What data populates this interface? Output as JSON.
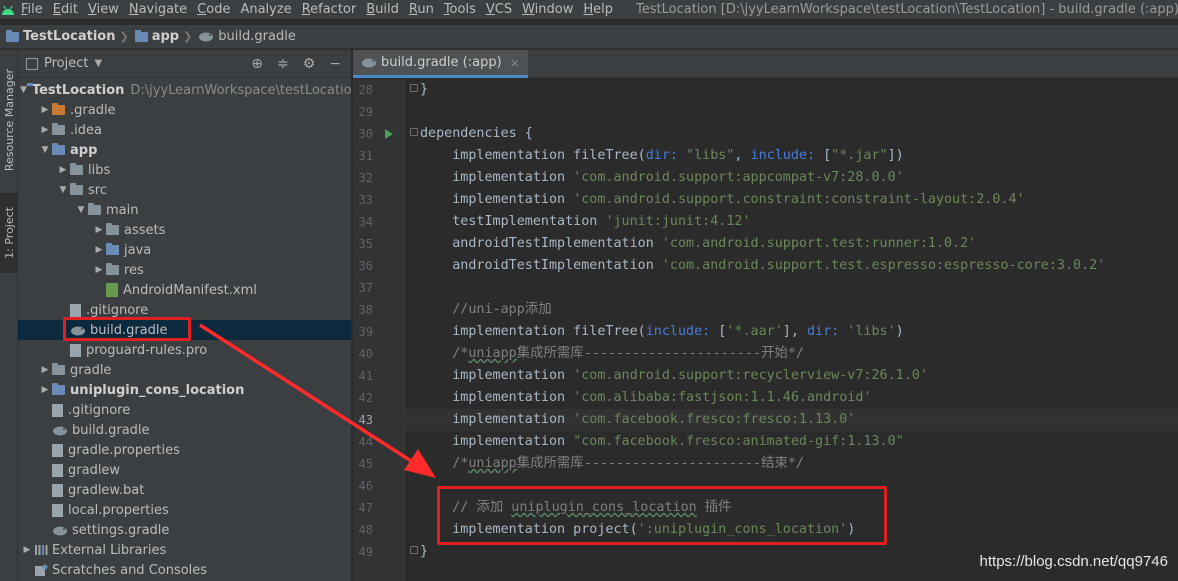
{
  "menubar": {
    "items": [
      {
        "label": "File",
        "mnemonic": "F",
        "rest": "ile"
      },
      {
        "label": "Edit",
        "mnemonic": "E",
        "rest": "dit"
      },
      {
        "label": "View",
        "mnemonic": "V",
        "rest": "iew"
      },
      {
        "label": "Navigate",
        "mnemonic": "N",
        "rest": "avigate"
      },
      {
        "label": "Code",
        "mnemonic": "C",
        "rest": "ode"
      },
      {
        "label": "Analyze",
        "mnemonic": "",
        "rest": "Analyze"
      },
      {
        "label": "Refactor",
        "mnemonic": "R",
        "rest": "efactor"
      },
      {
        "label": "Build",
        "mnemonic": "B",
        "rest": "uild"
      },
      {
        "label": "Run",
        "mnemonic": "R",
        "rest": "un"
      },
      {
        "label": "Tools",
        "mnemonic": "T",
        "rest": "ools"
      },
      {
        "label": "VCS",
        "mnemonic": "V",
        "rest": "CS"
      },
      {
        "label": "Window",
        "mnemonic": "W",
        "rest": "indow"
      },
      {
        "label": "Help",
        "mnemonic": "H",
        "rest": "elp"
      }
    ],
    "window_title": "TestLocation [D:\\jyyLearnWorkspace\\testLocation\\TestLocation] - build.gradle (:app) - Android S"
  },
  "breadcrumbs": {
    "project": "TestLocation",
    "module": "app",
    "file": "build.gradle"
  },
  "left_strip": {
    "resource_manager": "Resource Manager",
    "project_tab": "1: Project"
  },
  "project_panel": {
    "title": "Project",
    "tree": [
      {
        "label": "TestLocation",
        "path": "D:\\jyyLearnWorkspace\\testLocation\\",
        "indent": 0,
        "arrow": "open",
        "icon": "folder-blue",
        "bold": true
      },
      {
        "label": ".gradle",
        "indent": 1,
        "arrow": "closed",
        "icon": "folder-orange"
      },
      {
        "label": ".idea",
        "indent": 1,
        "arrow": "closed",
        "icon": "folder"
      },
      {
        "label": "app",
        "indent": 1,
        "arrow": "open",
        "icon": "folder-blue",
        "bold": true
      },
      {
        "label": "libs",
        "indent": 2,
        "arrow": "closed",
        "icon": "folder"
      },
      {
        "label": "src",
        "indent": 2,
        "arrow": "open",
        "icon": "folder"
      },
      {
        "label": "main",
        "indent": 3,
        "arrow": "open",
        "icon": "folder"
      },
      {
        "label": "assets",
        "indent": 4,
        "arrow": "closed",
        "icon": "folder"
      },
      {
        "label": "java",
        "indent": 4,
        "arrow": "closed",
        "icon": "folder-blue"
      },
      {
        "label": "res",
        "indent": 4,
        "arrow": "closed",
        "icon": "folder"
      },
      {
        "label": "AndroidManifest.xml",
        "indent": 4,
        "arrow": "none",
        "icon": "manifest"
      },
      {
        "label": ".gitignore",
        "indent": 2,
        "arrow": "none",
        "icon": "file"
      },
      {
        "label": "build.gradle",
        "indent": 2,
        "arrow": "none",
        "icon": "gradle",
        "selected": true
      },
      {
        "label": "proguard-rules.pro",
        "indent": 2,
        "arrow": "none",
        "icon": "file"
      },
      {
        "label": "gradle",
        "indent": 1,
        "arrow": "closed",
        "icon": "folder"
      },
      {
        "label": "uniplugin_cons_location",
        "indent": 1,
        "arrow": "closed",
        "icon": "folder-blue",
        "bold": true
      },
      {
        "label": ".gitignore",
        "indent": 1,
        "arrow": "none",
        "icon": "file"
      },
      {
        "label": "build.gradle",
        "indent": 1,
        "arrow": "none",
        "icon": "gradle"
      },
      {
        "label": "gradle.properties",
        "indent": 1,
        "arrow": "none",
        "icon": "file"
      },
      {
        "label": "gradlew",
        "indent": 1,
        "arrow": "none",
        "icon": "file"
      },
      {
        "label": "gradlew.bat",
        "indent": 1,
        "arrow": "none",
        "icon": "file"
      },
      {
        "label": "local.properties",
        "indent": 1,
        "arrow": "none",
        "icon": "file"
      },
      {
        "label": "settings.gradle",
        "indent": 1,
        "arrow": "none",
        "icon": "gradle"
      },
      {
        "label": "External Libraries",
        "indent": 0,
        "arrow": "closed",
        "icon": "libs"
      },
      {
        "label": "Scratches and Consoles",
        "indent": 0,
        "arrow": "none",
        "icon": "scratch"
      }
    ]
  },
  "editor": {
    "tab_label": "build.gradle (:app)",
    "tab_close": "×",
    "current_line": 43,
    "lines": [
      {
        "n": 28,
        "parts": [
          [
            "p",
            "}"
          ]
        ]
      },
      {
        "n": 29,
        "parts": []
      },
      {
        "n": 30,
        "parts": [
          [
            "p",
            "dependencies {"
          ]
        ]
      },
      {
        "n": 31,
        "parts": [
          [
            "p",
            "    implementation fileTree("
          ],
          [
            "k",
            "dir: "
          ],
          [
            "s",
            "\"libs\""
          ],
          [
            "p",
            ", "
          ],
          [
            "k",
            "include: "
          ],
          [
            "p",
            "["
          ],
          [
            "s",
            "\"*.jar\""
          ],
          [
            "p",
            "])"
          ]
        ]
      },
      {
        "n": 32,
        "parts": [
          [
            "p",
            "    implementation "
          ],
          [
            "s",
            "'com.android.support:appcompat-v7:28.0.0'"
          ]
        ]
      },
      {
        "n": 33,
        "parts": [
          [
            "p",
            "    implementation "
          ],
          [
            "s",
            "'com.android.support.constraint:constraint-layout:2.0.4'"
          ]
        ]
      },
      {
        "n": 34,
        "parts": [
          [
            "p",
            "    testImplementation "
          ],
          [
            "s",
            "'junit:junit:4.12'"
          ]
        ]
      },
      {
        "n": 35,
        "parts": [
          [
            "p",
            "    androidTestImplementation "
          ],
          [
            "s",
            "'com.android.support.test:runner:1.0.2'"
          ]
        ]
      },
      {
        "n": 36,
        "parts": [
          [
            "p",
            "    androidTestImplementation "
          ],
          [
            "s",
            "'com.android.support.test.espresso:espresso-core:3.0.2'"
          ]
        ]
      },
      {
        "n": 37,
        "parts": []
      },
      {
        "n": 38,
        "parts": [
          [
            "c",
            "    //uni-app添加"
          ]
        ]
      },
      {
        "n": 39,
        "parts": [
          [
            "p",
            "    implementation fileTree("
          ],
          [
            "k",
            "include: "
          ],
          [
            "p",
            "["
          ],
          [
            "s",
            "'*.aar'"
          ],
          [
            "p",
            "], "
          ],
          [
            "k",
            "dir: "
          ],
          [
            "s",
            "'libs'"
          ],
          [
            "p",
            ")"
          ]
        ]
      },
      {
        "n": 40,
        "parts": [
          [
            "c",
            "    /*"
          ],
          [
            "cu",
            "uniapp"
          ],
          [
            "c",
            "集成所需库----------------------开始*/"
          ]
        ]
      },
      {
        "n": 41,
        "parts": [
          [
            "p",
            "    implementation "
          ],
          [
            "s",
            "'com.android.support:recyclerview-v7:26.1.0'"
          ]
        ]
      },
      {
        "n": 42,
        "parts": [
          [
            "p",
            "    implementation "
          ],
          [
            "s",
            "'com.alibaba:fastjson:1.1.46.android'"
          ]
        ]
      },
      {
        "n": 43,
        "parts": [
          [
            "p",
            "    implementation "
          ],
          [
            "s",
            "'com.facebook.fresco:fresco:1.13.0'"
          ]
        ]
      },
      {
        "n": 44,
        "parts": [
          [
            "p",
            "    implementation "
          ],
          [
            "s",
            "\"com.facebook.fresco:animated-gif:1.13.0\""
          ]
        ]
      },
      {
        "n": 45,
        "parts": [
          [
            "c",
            "    /*"
          ],
          [
            "cu",
            "uniapp"
          ],
          [
            "c",
            "集成所需库----------------------结束*/"
          ]
        ]
      },
      {
        "n": 46,
        "parts": []
      },
      {
        "n": 47,
        "parts": [
          [
            "c",
            "    // 添加 "
          ],
          [
            "cu",
            "uniplugin_cons_location"
          ],
          [
            "c",
            " 插件"
          ]
        ]
      },
      {
        "n": 48,
        "parts": [
          [
            "p",
            "    implementation project("
          ],
          [
            "s",
            "':uniplugin_cons_location'"
          ],
          [
            "p",
            ")"
          ]
        ]
      },
      {
        "n": 49,
        "parts": [
          [
            "p",
            "}"
          ]
        ]
      }
    ]
  },
  "watermark": "https://blog.csdn.net/qq9746",
  "colors": {
    "string": "#6a8759",
    "named_arg": "#467cda",
    "comment": "#808080",
    "plain": "#a9b7c6",
    "highlight_box": "#e02020",
    "selection": "#0d293e"
  }
}
